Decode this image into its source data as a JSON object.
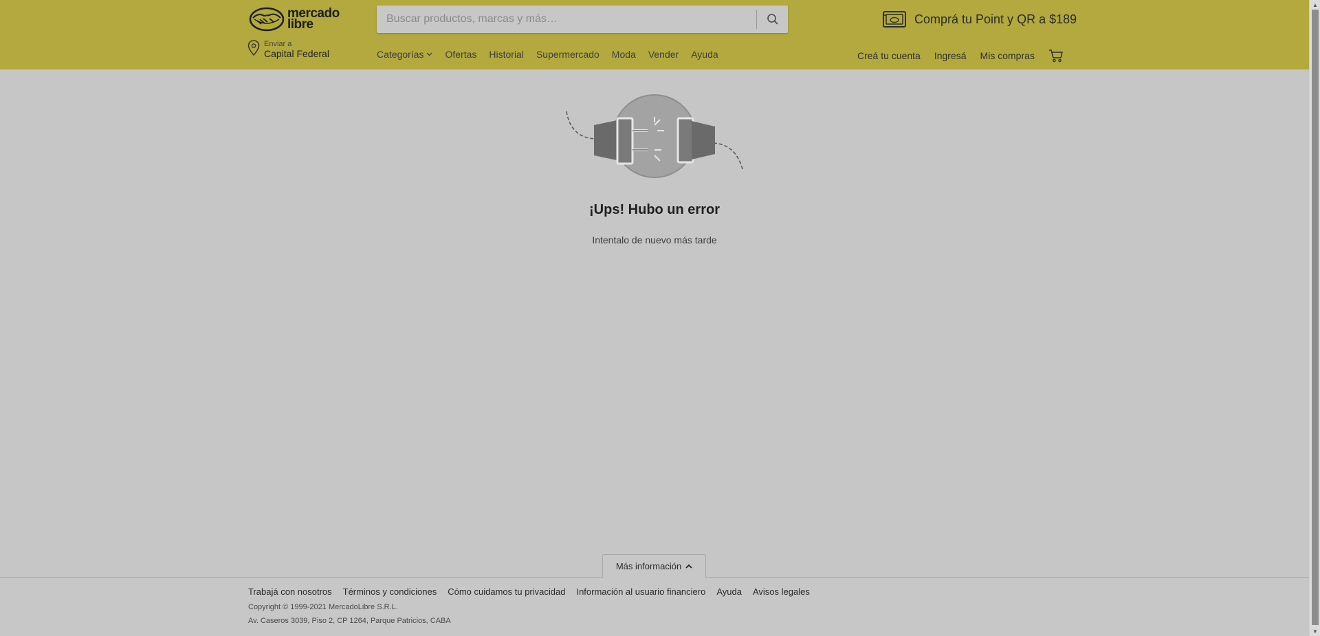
{
  "header": {
    "logo": {
      "line1": "mercado",
      "line2": "libre"
    },
    "search": {
      "placeholder": "Buscar productos, marcas y más…"
    },
    "promo": {
      "text": "Comprá tu Point y QR a $189"
    },
    "location": {
      "label": "Enviar a",
      "value": "Capital Federal"
    },
    "nav": [
      {
        "label": "Categorías"
      },
      {
        "label": "Ofertas"
      },
      {
        "label": "Historial"
      },
      {
        "label": "Supermercado"
      },
      {
        "label": "Moda"
      },
      {
        "label": "Vender"
      },
      {
        "label": "Ayuda"
      }
    ],
    "user_nav": [
      {
        "label": "Creá tu cuenta"
      },
      {
        "label": "Ingresá"
      },
      {
        "label": "Mis compras"
      }
    ]
  },
  "error": {
    "title": "¡Ups! Hubo un error",
    "subtitle": "Intentalo de nuevo más tarde",
    "icon": "disconnected-plug-icon"
  },
  "footer": {
    "more_info": "Más información",
    "links": [
      {
        "label": "Trabajá con nosotros"
      },
      {
        "label": "Términos y condiciones"
      },
      {
        "label": "Cómo cuidamos tu privacidad"
      },
      {
        "label": "Información al usuario financiero"
      },
      {
        "label": "Ayuda"
      },
      {
        "label": "Avisos legales"
      }
    ],
    "copyright": "Copyright © 1999-2021 MercadoLibre S.R.L.",
    "address": "Av. Caseros 3039, Piso 2, CP 1264, Parque Patricios, CABA"
  },
  "colors": {
    "header_bg": "#b3a93e",
    "page_bg": "#c6c6c6"
  }
}
